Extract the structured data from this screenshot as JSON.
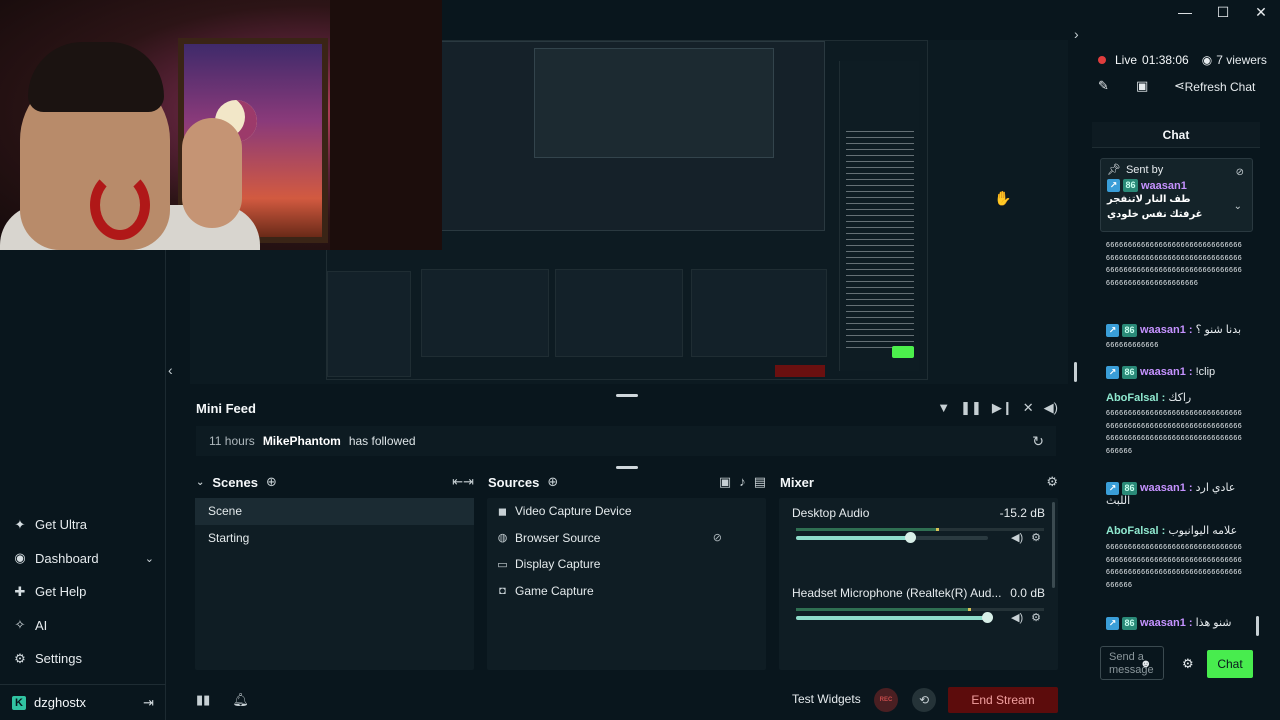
{
  "window": {
    "minimize": "—",
    "maximize": "☐",
    "close": "✕"
  },
  "sidebar": {
    "items": [
      {
        "label": "Get Ultra",
        "icon": "ultra-icon"
      },
      {
        "label": "Dashboard",
        "icon": "dashboard-icon"
      },
      {
        "label": "Get Help",
        "icon": "help-icon"
      },
      {
        "label": "AI",
        "icon": "ai-sparkle-icon"
      },
      {
        "label": "Settings",
        "icon": "gear-icon"
      }
    ],
    "user": "dzghostx"
  },
  "mini_feed": {
    "title": "Mini Feed",
    "event": {
      "time": "11 hours",
      "user": "MikePhantom",
      "action": "has followed"
    }
  },
  "scenes": {
    "title": "Scenes",
    "items": [
      "Scene",
      "Starting"
    ],
    "active": "Scene"
  },
  "sources": {
    "title": "Sources",
    "items": [
      {
        "label": "Video Capture Device",
        "icon": "camera-icon"
      },
      {
        "label": "Browser Source",
        "icon": "globe-icon"
      },
      {
        "label": "Display Capture",
        "icon": "monitor-icon"
      },
      {
        "label": "Game Capture",
        "icon": "gamepad-icon"
      }
    ]
  },
  "mixer": {
    "title": "Mixer",
    "channels": [
      {
        "name": "Desktop Audio",
        "db": "-15.2 dB",
        "volume": 0.6
      },
      {
        "name": "Headset Microphone (Realtek(R) Aud...",
        "db": "0.0 dB",
        "volume": 1.0
      }
    ]
  },
  "bottom_bar": {
    "test_widgets": "Test Widgets",
    "rec": "REC",
    "end_stream": "End Stream"
  },
  "stream": {
    "status": "Live",
    "time": "01:38:06",
    "viewers": "7 viewers"
  },
  "chat": {
    "refresh": "Refresh Chat",
    "title": "Chat",
    "pinned": {
      "header": "Sent by",
      "user": "waasan1",
      "message": "طف النار لاتنفجر غرفتك نفس خلودي"
    },
    "messages": [
      {
        "sixes": "666666666666666666666666666666666666666666666666666666666666666666666666666666666666666666666666666666666666666666"
      },
      {
        "user": "waasan1",
        "text": "بدنا شنو ؟"
      },
      {
        "sixes": "666666666666"
      },
      {
        "user": "waasan1",
        "text": "!clip"
      },
      {
        "user": "AboFalsal",
        "text": "راكك"
      },
      {
        "sixes": "666666666666666666666666666666666666666666666666666666666666666666666666666666666666666666666666666"
      },
      {
        "user": "waasan1",
        "text": "عادي ارد اللبث"
      },
      {
        "user": "AboFalsal",
        "text": "علامه اليوانيوب"
      },
      {
        "sixes": "666666666666666666666666666666666666666666666666666666666666666666666666666666666666666666666666666"
      },
      {
        "user": "waasan1",
        "text": "شنو هذا"
      }
    ],
    "input_placeholder": "Send a message",
    "send": "Chat"
  },
  "colors": {
    "accent_green": "#48ec4e",
    "end_red": "#5c0c0c",
    "user_purple": "#c592ff",
    "user_teal": "#8fe8cf",
    "live_red": "#e03d3d"
  }
}
